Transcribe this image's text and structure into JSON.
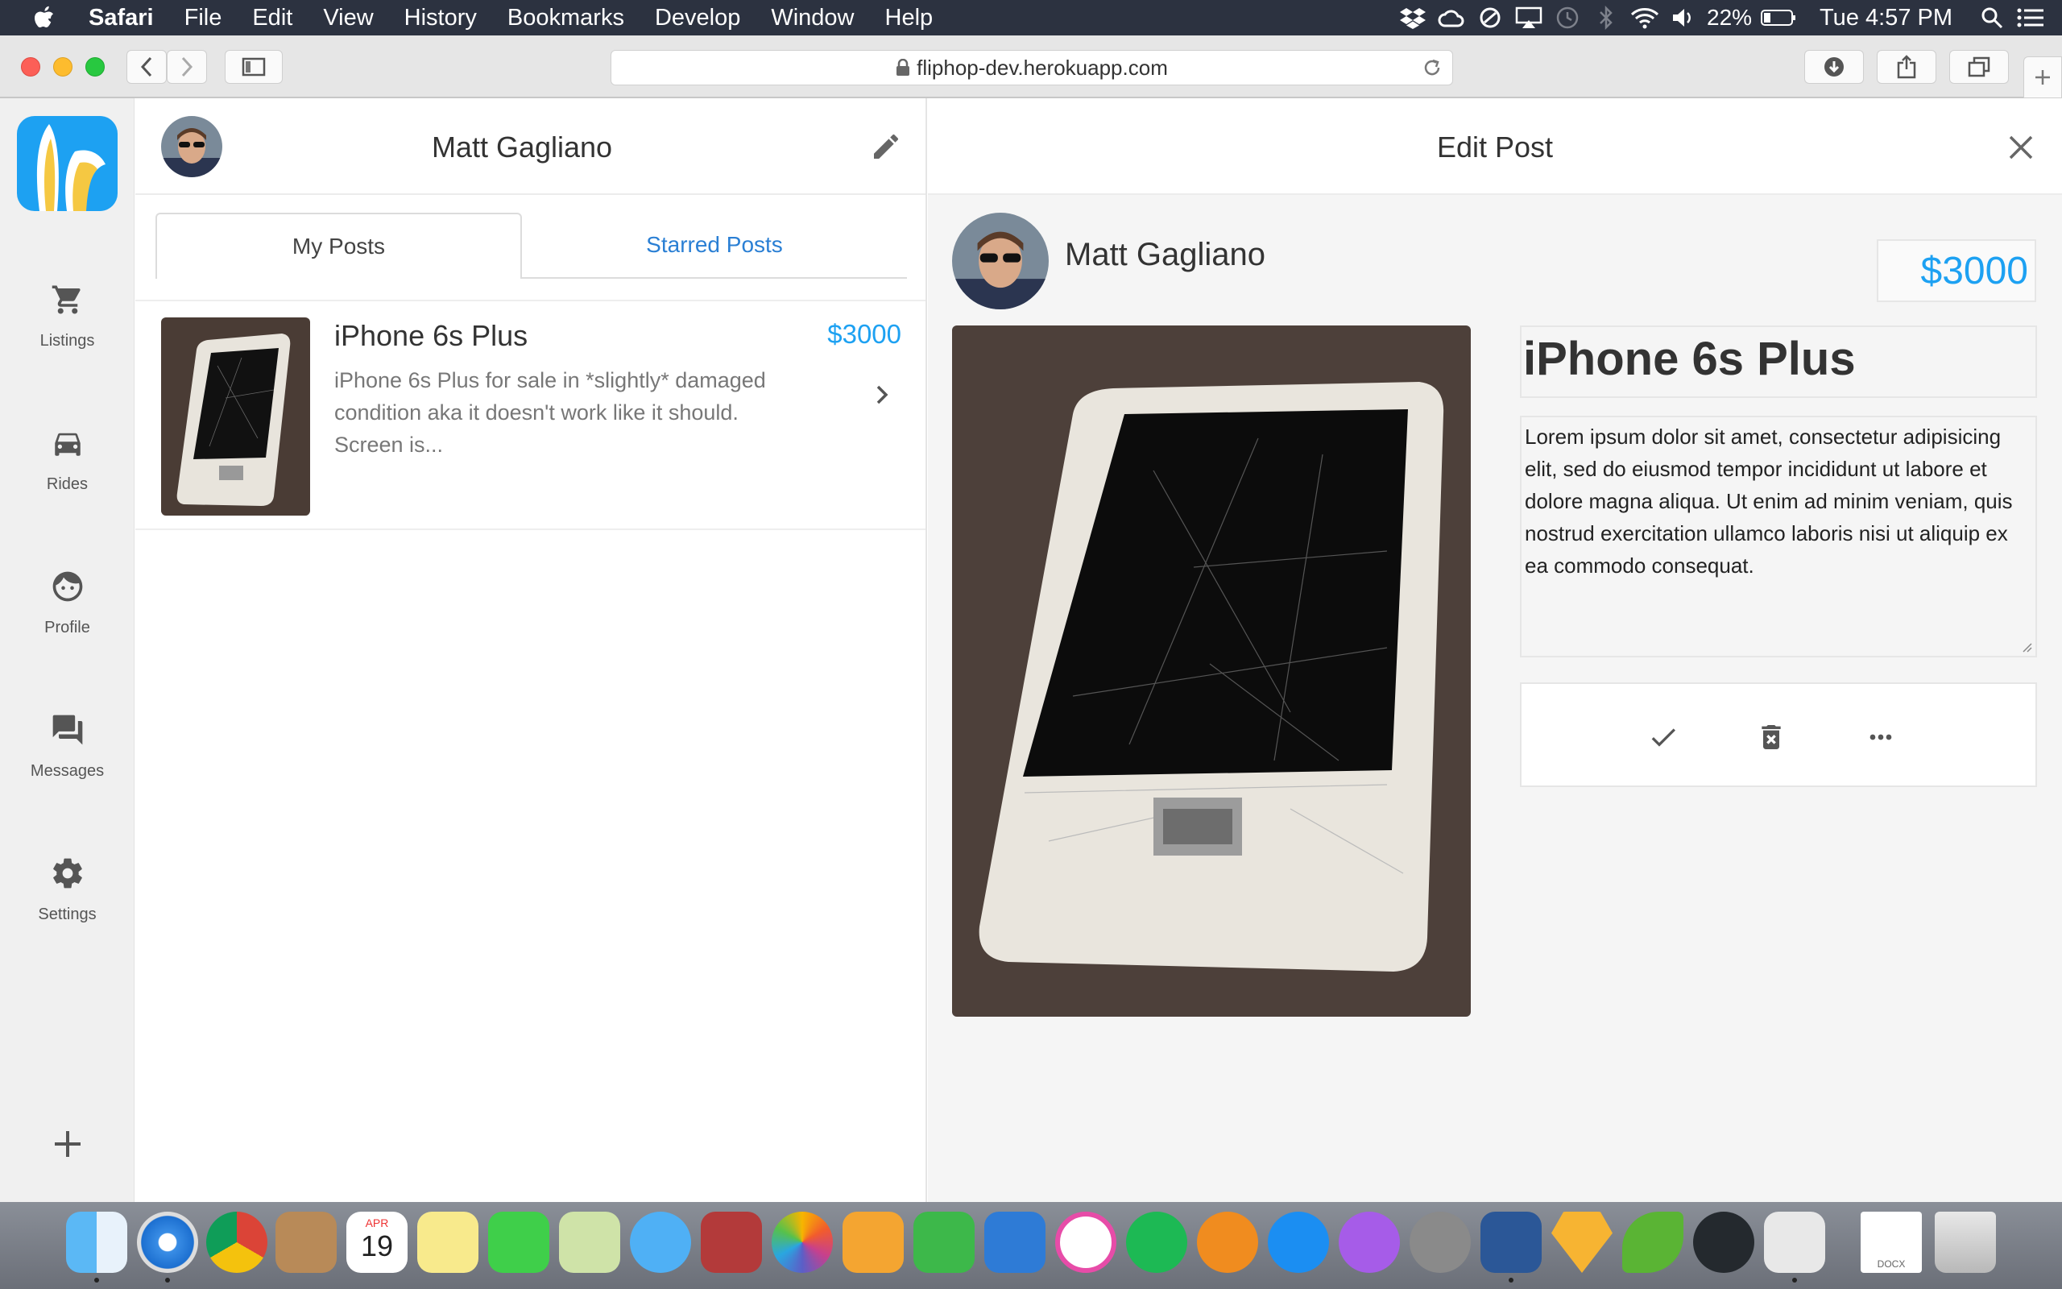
{
  "menubar": {
    "app": "Safari",
    "items": [
      "File",
      "Edit",
      "View",
      "History",
      "Bookmarks",
      "Develop",
      "Window",
      "Help"
    ],
    "battery": "22%",
    "clock": "Tue 4:57 PM"
  },
  "browser": {
    "url": "fliphop-dev.herokuapp.com"
  },
  "sidebar": {
    "items": [
      {
        "label": "Listings",
        "icon": "cart-icon"
      },
      {
        "label": "Rides",
        "icon": "car-icon"
      },
      {
        "label": "Profile",
        "icon": "face-icon"
      },
      {
        "label": "Messages",
        "icon": "chat-icon"
      },
      {
        "label": "Settings",
        "icon": "gear-icon"
      }
    ]
  },
  "left_panel": {
    "user_name": "Matt Gagliano",
    "tabs": [
      "My Posts",
      "Starred Posts"
    ],
    "posts": [
      {
        "title": "iPhone 6s Plus",
        "price": "$3000",
        "description": "iPhone 6s Plus for sale in *slightly* damaged condition aka it doesn't work like it should. Screen is..."
      }
    ]
  },
  "edit_post": {
    "header": "Edit Post",
    "user_name": "Matt Gagliano",
    "price": "$3000",
    "title": "iPhone 6s Plus",
    "description": "Lorem ipsum dolor sit amet, consectetur adipisicing elit, sed do eiusmod tempor incididunt ut labore et dolore magna aliqua. Ut enim ad minim veniam, quis nostrud exercitation ullamco laboris nisi ut aliquip ex ea commodo consequat."
  },
  "dock": {
    "apps": [
      "finder-icon",
      "safari-icon",
      "chrome-icon",
      "contacts-icon",
      "calendar-icon",
      "notes-icon",
      "facetime-icon",
      "maps-icon",
      "messages-icon",
      "photo-booth-icon",
      "photos-icon",
      "pages-icon",
      "numbers-icon",
      "keynote-icon",
      "itunes-icon",
      "spotify-icon",
      "ibooks-icon",
      "app-store-icon",
      "feedback-icon",
      "system-preferences-icon",
      "word-icon",
      "sketch-icon",
      "leaf-icon",
      "github-icon",
      "slack-icon",
      "docx-icon",
      "trash-icon"
    ],
    "calendar_month": "APR",
    "calendar_day": "19",
    "docx_label": "DOCX"
  },
  "colors": {
    "accent": "#1da1f2",
    "link": "#2a7fd4",
    "menubar": "#2c3240"
  }
}
